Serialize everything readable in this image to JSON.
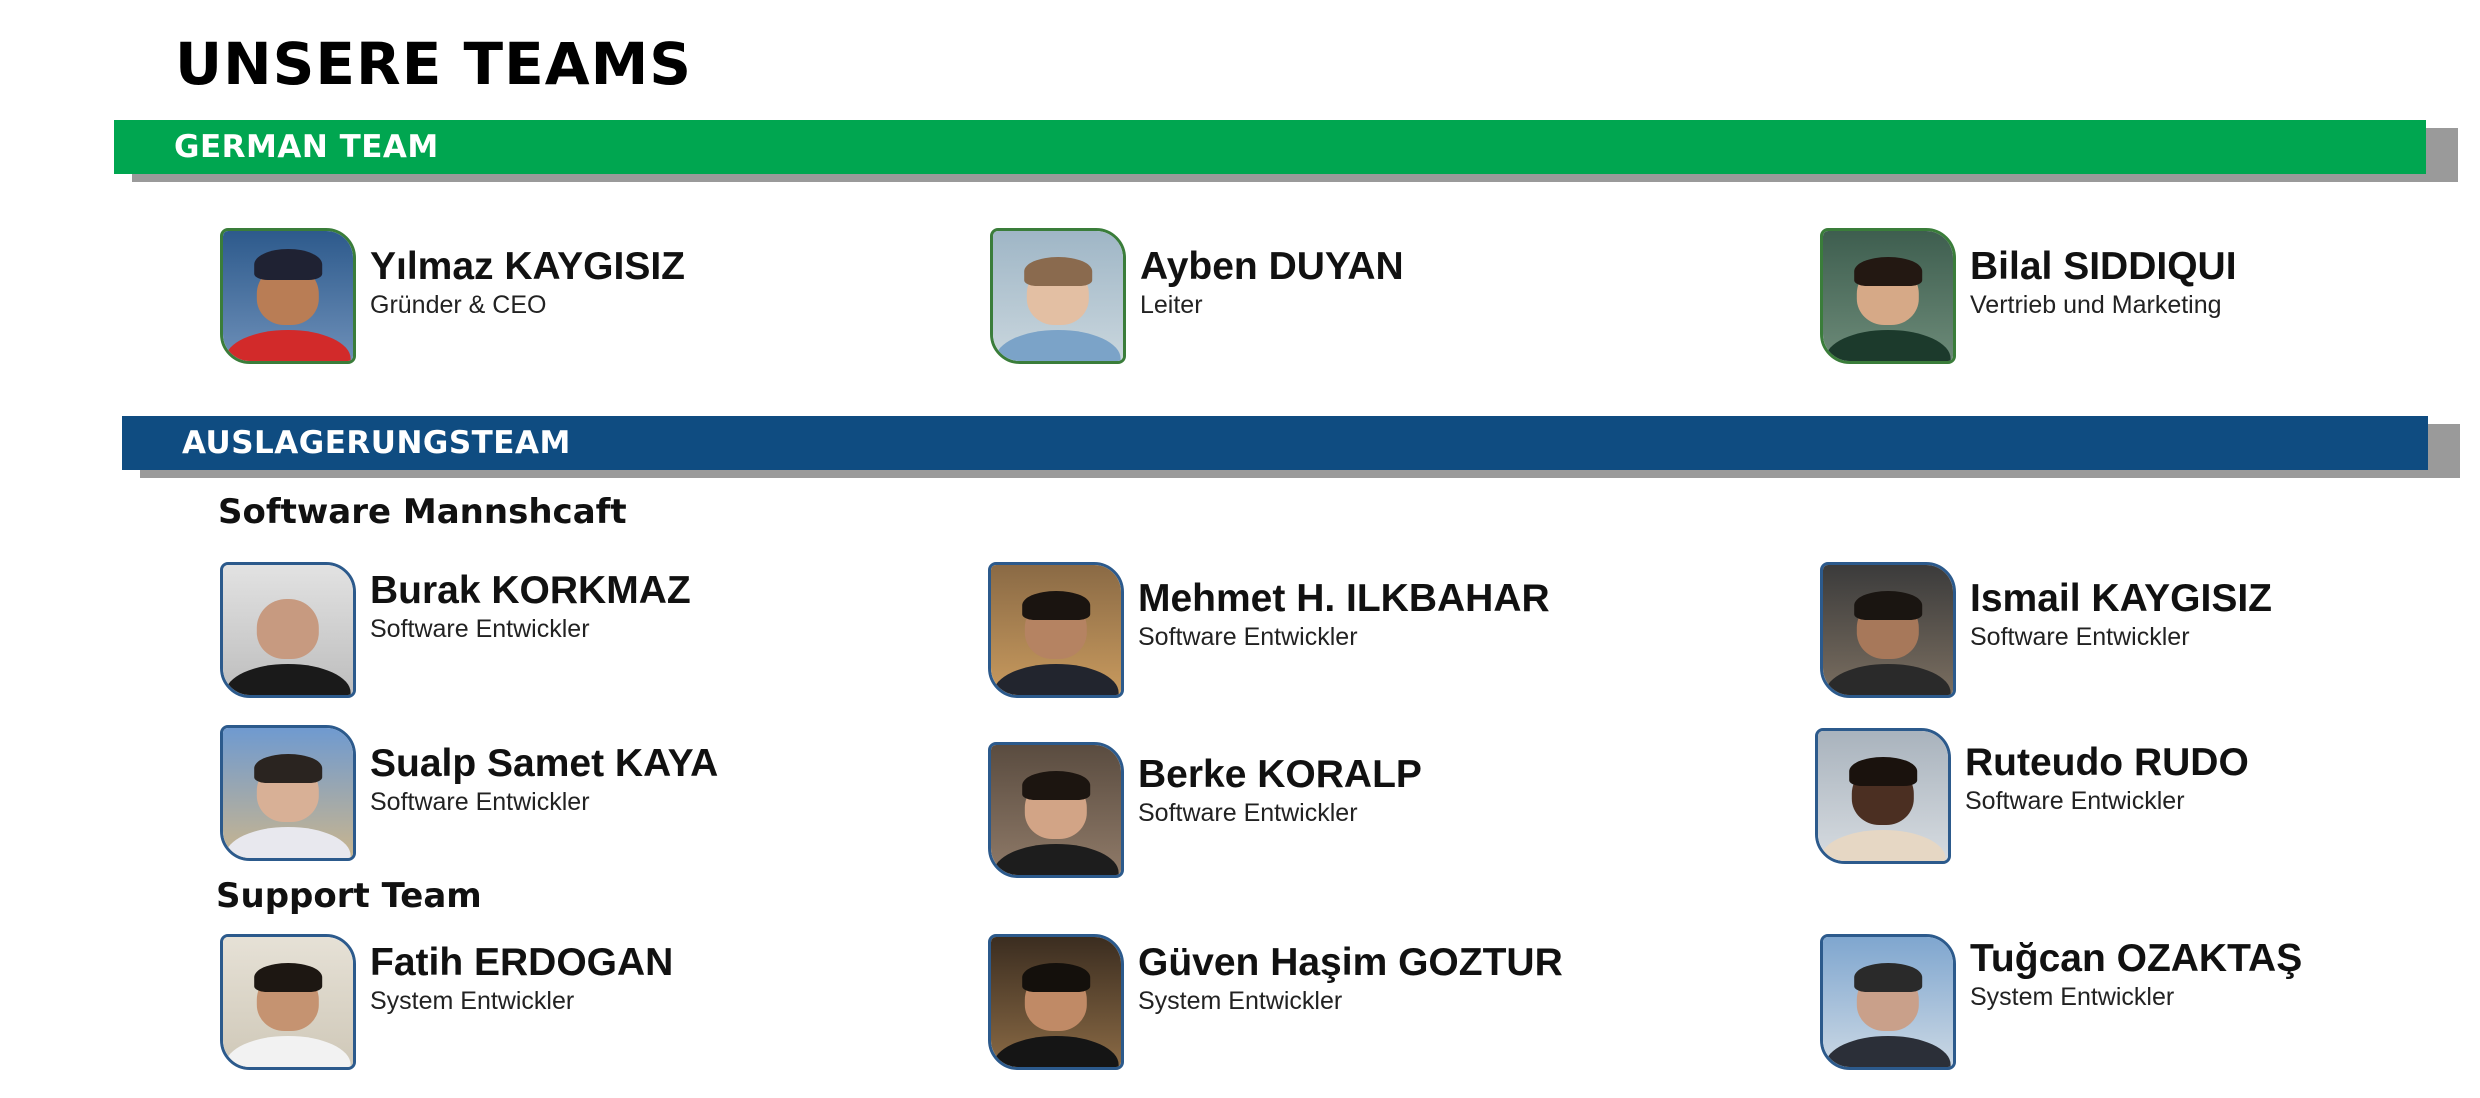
{
  "page_title": "UNSERE TEAMS",
  "colors": {
    "german_banner": "#00a650",
    "outsource_banner": "#0f4c81",
    "shadow": "#9a9a9a"
  },
  "german_team": {
    "banner": "GERMAN TEAM",
    "members": [
      {
        "name": "Yılmaz KAYGISIZ",
        "role": "Gründer & CEO"
      },
      {
        "name": "Ayben DUYAN",
        "role": "Leiter"
      },
      {
        "name": "Bilal SIDDIQUI",
        "role": "Vertrieb und Marketing"
      }
    ]
  },
  "outsource_team": {
    "banner": "AUSLAGERUNGSTEAM",
    "software": {
      "heading": "Software Mannshcaft",
      "members": [
        {
          "name": "Burak KORKMAZ",
          "role": "Software Entwickler"
        },
        {
          "name": "Mehmet H. ILKBAHAR",
          "role": "Software Entwickler"
        },
        {
          "name": "Ismail KAYGISIZ",
          "role": "Software Entwickler"
        },
        {
          "name": "Sualp Samet KAYA",
          "role": "Software Entwickler"
        },
        {
          "name": "Berke KORALP",
          "role": "Software Entwickler"
        },
        {
          "name": "Ruteudo RUDO",
          "role": "Software Entwickler"
        }
      ]
    },
    "support": {
      "heading": "Support Team",
      "members": [
        {
          "name": "Fatih ERDOGAN",
          "role": "System Entwickler"
        },
        {
          "name": "Güven Haşim GOZTUR",
          "role": "System Entwickler"
        },
        {
          "name": "Tuğcan OZAKTAŞ",
          "role": "System Entwickler"
        }
      ]
    }
  }
}
